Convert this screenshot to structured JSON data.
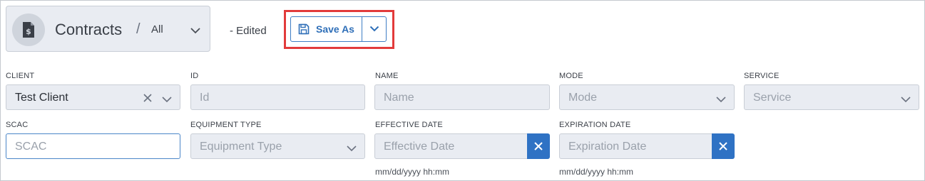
{
  "header": {
    "title": "Contracts",
    "separator": "/",
    "view": "All",
    "edited_label": "- Edited",
    "save_as_label": "Save As"
  },
  "form": {
    "client": {
      "label": "CLIENT",
      "value": "Test Client"
    },
    "id": {
      "label": "ID",
      "placeholder": "Id"
    },
    "name": {
      "label": "NAME",
      "placeholder": "Name"
    },
    "mode": {
      "label": "MODE",
      "placeholder": "Mode"
    },
    "service": {
      "label": "SERVICE",
      "placeholder": "Service"
    },
    "scac": {
      "label": "SCAC",
      "placeholder": "SCAC"
    },
    "equipment_type": {
      "label": "EQUIPMENT TYPE",
      "placeholder": "Equipment Type"
    },
    "effective_date": {
      "label": "EFFECTIVE DATE",
      "placeholder": "Effective Date",
      "hint": "mm/dd/yyyy hh:mm"
    },
    "expiration_date": {
      "label": "EXPIRATION DATE",
      "placeholder": "Expiration Date",
      "hint": "mm/dd/yyyy hh:mm"
    }
  },
  "icons": {
    "view": "contract-document-icon",
    "save": "floppy-disk-icon"
  },
  "colors": {
    "accent": "#2f72c4",
    "highlight": "#e23b3b",
    "field_bg": "#e9ecf2"
  }
}
